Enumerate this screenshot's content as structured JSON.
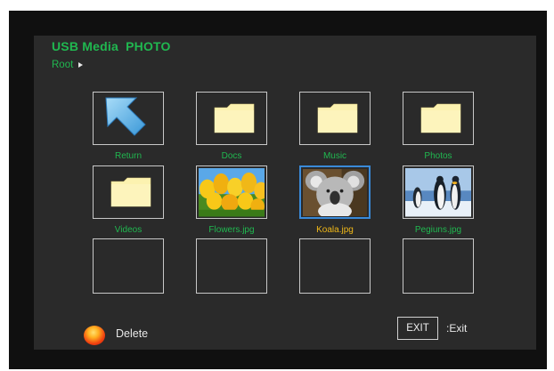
{
  "header": {
    "title": "USB Media  PHOTO",
    "breadcrumb": "Root"
  },
  "colors": {
    "accent_green": "#20b850",
    "selected_caption": "#f0b818",
    "selected_border": "#3a8ad8",
    "folder_fill": "#fcf2b0"
  },
  "grid": [
    {
      "label": "Return",
      "kind": "return",
      "icon": "back-arrow-icon"
    },
    {
      "label": "Docs",
      "kind": "folder",
      "icon": "folder-icon"
    },
    {
      "label": "Music",
      "kind": "folder",
      "icon": "folder-icon"
    },
    {
      "label": "Photos",
      "kind": "folder",
      "icon": "folder-icon"
    },
    {
      "label": "Videos",
      "kind": "folder",
      "icon": "folder-icon"
    },
    {
      "label": "Flowers.jpg",
      "kind": "image",
      "icon": "tulips-thumbnail"
    },
    {
      "label": "Koala.jpg",
      "kind": "image",
      "icon": "koala-thumbnail",
      "selected": true
    },
    {
      "label": "Pegiuns.jpg",
      "kind": "image",
      "icon": "penguins-thumbnail"
    },
    {
      "label": "",
      "kind": "empty"
    },
    {
      "label": "",
      "kind": "empty"
    },
    {
      "label": "",
      "kind": "empty"
    },
    {
      "label": "",
      "kind": "empty"
    }
  ],
  "footer": {
    "delete_label": "Delete",
    "exit_key": "EXIT",
    "exit_label": ":Exit"
  }
}
